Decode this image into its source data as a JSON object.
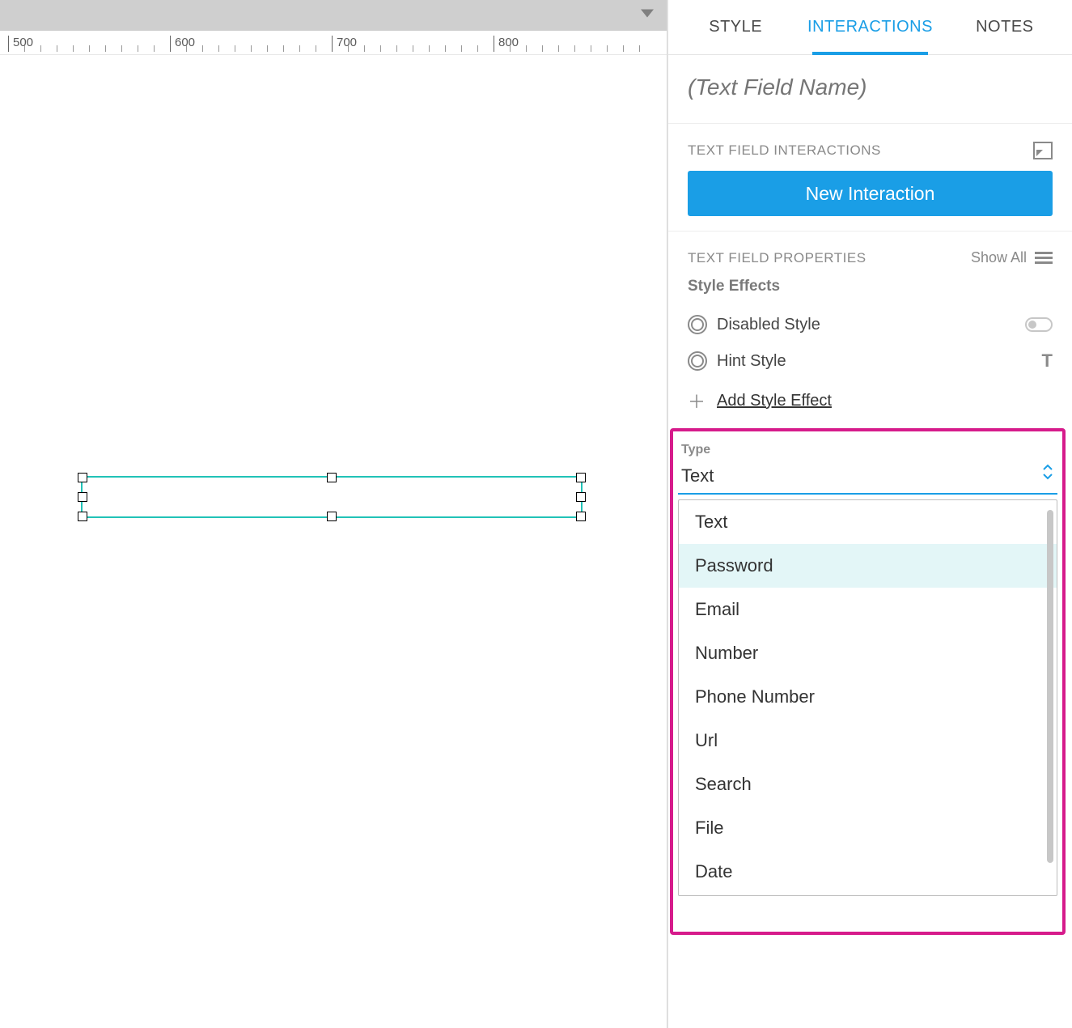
{
  "tabs": {
    "style": "STYLE",
    "interactions": "INTERACTIONS",
    "notes": "NOTES"
  },
  "name_field": {
    "placeholder": "(Text Field Name)"
  },
  "interactions_section": {
    "title": "TEXT FIELD INTERACTIONS",
    "new_button": "New Interaction"
  },
  "properties_section": {
    "title": "TEXT FIELD PROPERTIES",
    "show_all": "Show All",
    "style_effects_title": "Style Effects",
    "disabled_style": "Disabled Style",
    "hint_style": "Hint Style",
    "add_style_effect": "Add Style Effect"
  },
  "type_section": {
    "label": "Type",
    "selected": "Text",
    "options": [
      "Text",
      "Password",
      "Email",
      "Number",
      "Phone Number",
      "Url",
      "Search",
      "File",
      "Date"
    ],
    "highlighted_index": 1
  },
  "ruler": {
    "marks": [
      500,
      600,
      700,
      800
    ]
  }
}
